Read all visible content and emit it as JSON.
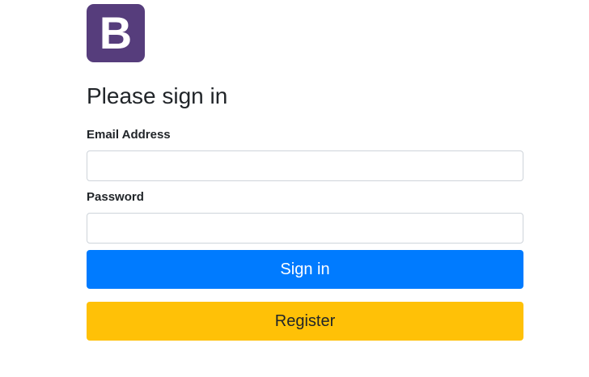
{
  "logo": {
    "letter": "B",
    "icon": "bootstrap-logo-icon",
    "color": "#563d7c"
  },
  "form": {
    "title": "Please sign in",
    "email": {
      "label": "Email Address",
      "value": "",
      "placeholder": ""
    },
    "password": {
      "label": "Password",
      "value": "",
      "placeholder": ""
    },
    "signin_label": "Sign in",
    "register_label": "Register"
  },
  "colors": {
    "primary": "#007bff",
    "warning": "#ffc107",
    "logo": "#563d7c"
  }
}
